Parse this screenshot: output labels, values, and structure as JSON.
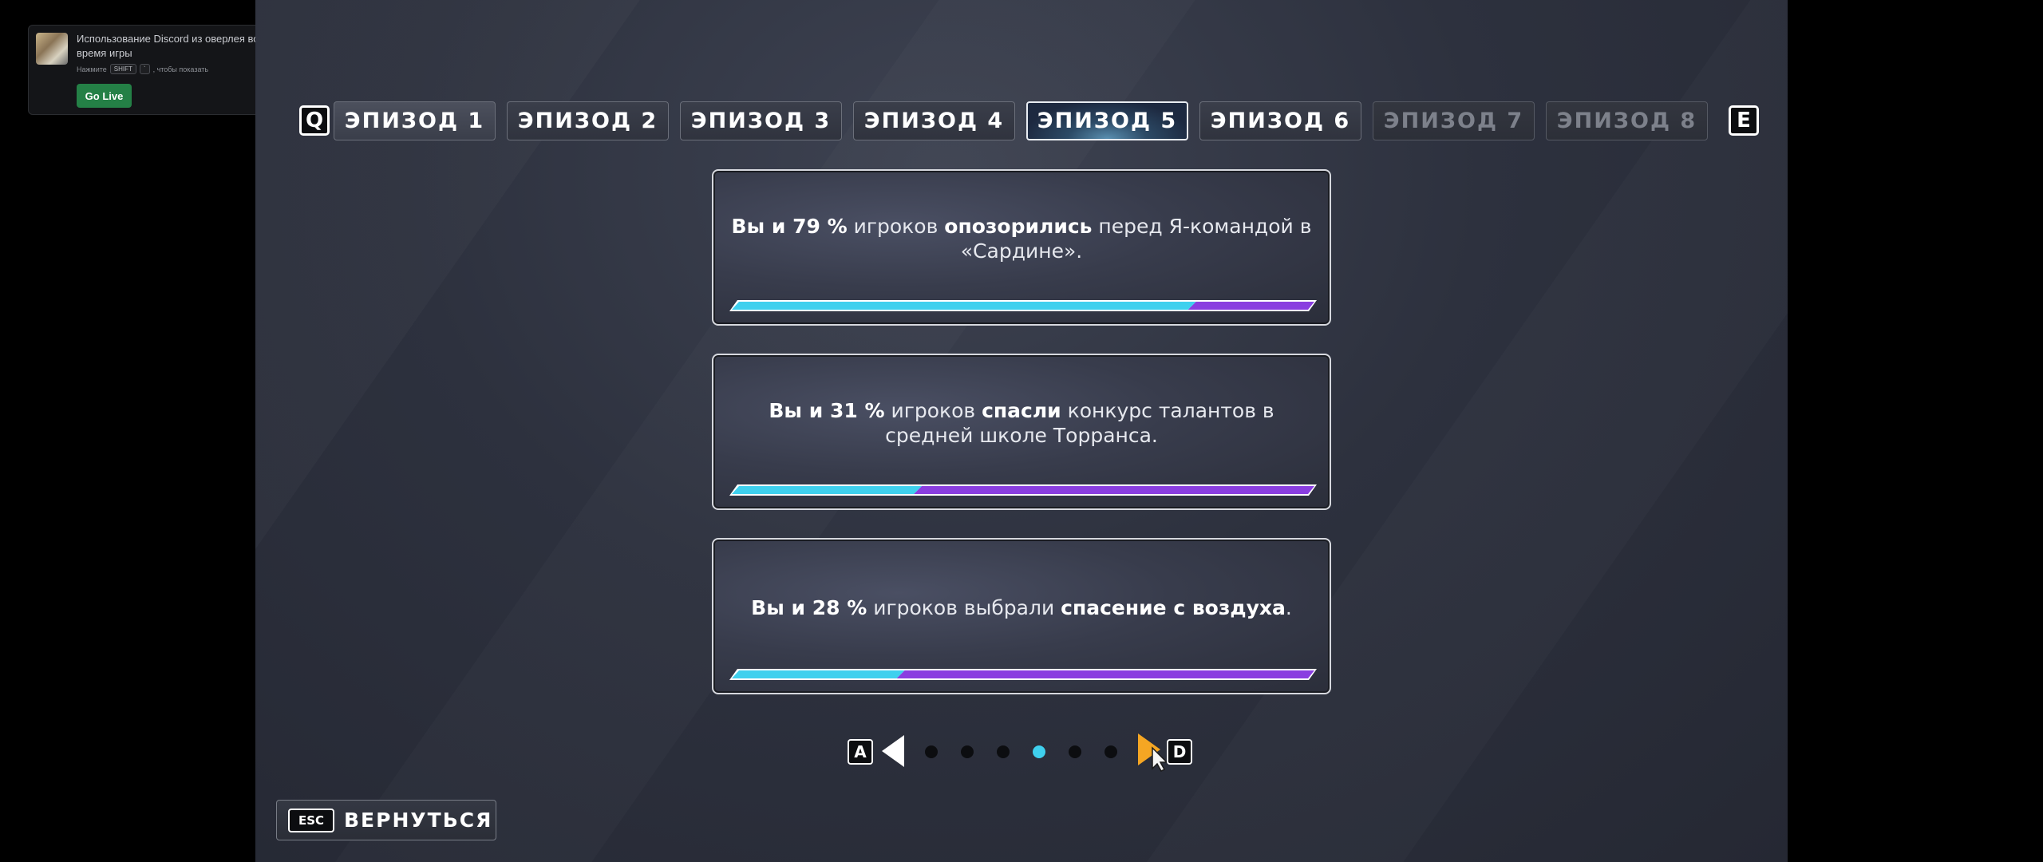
{
  "discord_overlay": {
    "title": "Использование Discord из оверлея во время игры",
    "hint_prefix": "Нажмите",
    "hint_key_1": "SHIFT",
    "hint_key_2": "`",
    "hint_suffix": ", чтобы показать",
    "go_live_label": "Go Live",
    "accent_color": "#248046"
  },
  "episode_nav": {
    "prev_key": "Q",
    "next_key": "E",
    "tabs": [
      {
        "label": "ЭПИЗОД 1",
        "state": "available"
      },
      {
        "label": "ЭПИЗОД 2",
        "state": "available"
      },
      {
        "label": "ЭПИЗОД 3",
        "state": "available"
      },
      {
        "label": "ЭПИЗОД 4",
        "state": "available"
      },
      {
        "label": "ЭПИЗОД 5",
        "state": "selected"
      },
      {
        "label": "ЭПИЗОД 6",
        "state": "available"
      },
      {
        "label": "ЭПИЗОД 7",
        "state": "locked"
      },
      {
        "label": "ЭПИЗОД 8",
        "state": "locked"
      }
    ]
  },
  "choices": [
    {
      "segments": [
        {
          "text": "Вы и 79 %",
          "bold": true
        },
        {
          "text": " игроков ",
          "bold": false
        },
        {
          "text": "опозорились",
          "bold": true
        },
        {
          "text": " перед Я-командой в «Сардине».",
          "bold": false
        }
      ],
      "percent": 79
    },
    {
      "segments": [
        {
          "text": "Вы и 31 %",
          "bold": true
        },
        {
          "text": " игроков ",
          "bold": false
        },
        {
          "text": "спасли",
          "bold": true
        },
        {
          "text": " конкурс талантов в средней школе Торранса.",
          "bold": false
        }
      ],
      "percent": 31
    },
    {
      "segments": [
        {
          "text": "Вы и 28 %",
          "bold": true
        },
        {
          "text": " игроков выбрали ",
          "bold": false
        },
        {
          "text": "спасение с воздуха",
          "bold": true
        },
        {
          "text": ".",
          "bold": false
        }
      ],
      "percent": 28
    }
  ],
  "bar_colors": {
    "player_share": "#3fd0ee",
    "others": "#8a3ee0"
  },
  "pager": {
    "prev_key": "A",
    "next_key": "D",
    "page_count": 6,
    "current_page": 4,
    "next_arrow_color": "#f5a623"
  },
  "back_button": {
    "key": "ESC",
    "label": "ВЕРНУТЬСЯ"
  }
}
